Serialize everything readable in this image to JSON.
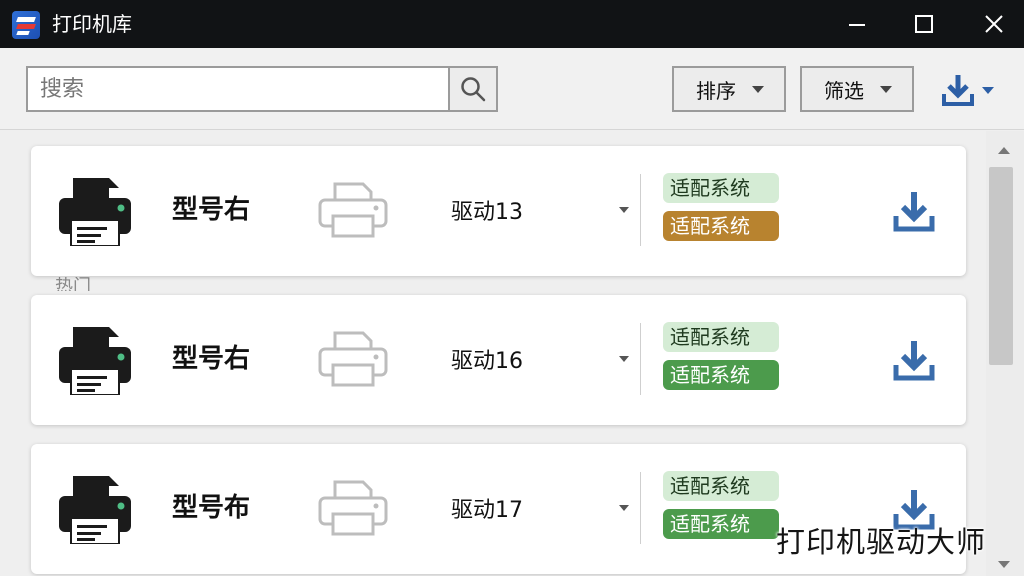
{
  "window": {
    "title": "打印机库"
  },
  "toolbar": {
    "search_placeholder": "搜索",
    "sort_label": "排序",
    "filter_label": "筛选"
  },
  "section": {
    "caption": "热门"
  },
  "cards": [
    {
      "model": "型号右",
      "driver": "驱动13",
      "badge_top": "适配系统",
      "badge_bottom": "适配系统",
      "badge_top_color": "#d5ecd5",
      "badge_bottom_color": "#b8832f"
    },
    {
      "model": "型号右",
      "driver": "驱动16",
      "badge_top": "适配系统",
      "badge_bottom": "适配系统",
      "badge_top_color": "#d5ecd5",
      "badge_bottom_color": "#4c9b4c"
    },
    {
      "model": "型号布",
      "driver": "驱动17",
      "badge_top": "适配系统",
      "badge_bottom": "适配系统",
      "badge_top_color": "#d5ecd5",
      "badge_bottom_color": "#4c9b4c"
    }
  ],
  "watermark": "打印机驱动大师",
  "colors": {
    "titlebar": "#111315",
    "accent_blue": "#2d5fa6"
  }
}
